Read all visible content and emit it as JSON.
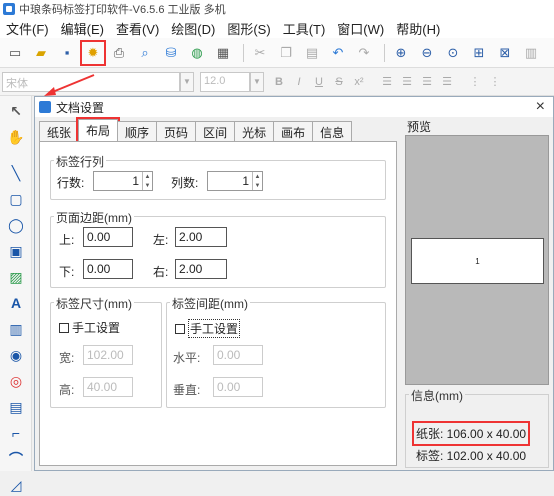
{
  "window": {
    "title": "中琅条码标签打印软件-V6.5.6 工业版 多机"
  },
  "menu": [
    "文件(F)",
    "编辑(E)",
    "查看(V)",
    "绘图(D)",
    "图形(S)",
    "工具(T)",
    "窗口(W)",
    "帮助(H)"
  ],
  "fontbar": {
    "font_name": "宋体",
    "font_size": "12.0"
  },
  "dialog": {
    "title": "文档设置",
    "close": "×",
    "tabs": [
      "纸张",
      "布局",
      "顺序",
      "页码",
      "区间",
      "光标",
      "画布",
      "信息"
    ],
    "active_tab": "布局",
    "label_rows_cols": {
      "legend": "标签行列",
      "rows_label": "行数:",
      "rows_value": "1",
      "cols_label": "列数:",
      "cols_value": "1"
    },
    "margins": {
      "legend": "页面边距(mm)",
      "top_label": "上:",
      "top_value": "0.00",
      "left_label": "左:",
      "left_value": "2.00",
      "bottom_label": "下:",
      "bottom_value": "0.00",
      "right_label": "右:",
      "right_value": "2.00"
    },
    "label_size": {
      "legend": "标签尺寸(mm)",
      "manual_label": "手工设置",
      "width_label": "宽:",
      "width_value": "102.00",
      "height_label": "高:",
      "height_value": "40.00"
    },
    "label_spacing": {
      "legend": "标签间距(mm)",
      "manual_label": "手工设置",
      "h_label": "水平:",
      "h_value": "0.00",
      "v_label": "垂直:",
      "v_value": "0.00"
    },
    "preview": {
      "label": "预览",
      "page_number": "1"
    },
    "info": {
      "legend": "信息(mm)",
      "paper": "纸张: 106.00 x 40.00",
      "label": "标签: 102.00 x 40.00"
    }
  }
}
